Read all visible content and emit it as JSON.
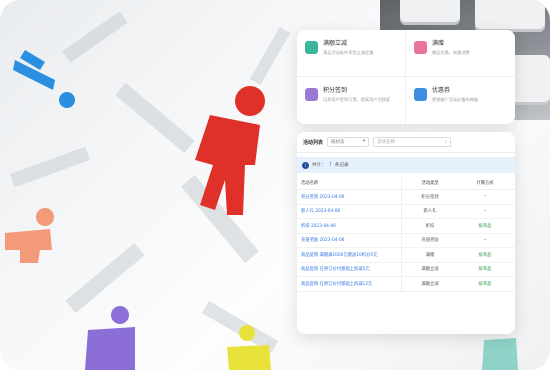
{
  "top_grid": [
    {
      "title": "满额立减",
      "desc": "满足活动条件享受立减优惠",
      "icon": "discount-icon",
      "color": "#3db59b"
    },
    {
      "title": "满赠",
      "desc": "赠品优惠，刺激消费",
      "icon": "gift-icon",
      "color": "#e9739c"
    },
    {
      "title": "积分签到",
      "desc": "培养用户签到习惯，提高用户活跃度",
      "icon": "calendar-icon",
      "color": "#9a7ad6"
    },
    {
      "title": "优惠券",
      "desc": "营销推广活动必备的神器",
      "icon": "coupon-icon",
      "color": "#3d8de0"
    }
  ],
  "list": {
    "tab": "活动列表",
    "status_select": "按状态",
    "search_placeholder": "活动名称",
    "info_prefix": "共计：",
    "info_count": "7",
    "info_suffix": "条记录",
    "columns": [
      "活动名称",
      "活动类型",
      "计算方式",
      ""
    ],
    "rows": [
      {
        "name": "积分签到 2023-04-06",
        "type": "积分签到",
        "calc": "--",
        "extra": "20"
      },
      {
        "name": "新人礼 2023-04-06",
        "type": "新人礼",
        "calc": "--",
        "extra": "20"
      },
      {
        "name": "折扣 2023-04-06",
        "type": "折扣",
        "calc": "按单品",
        "extra": "20"
      },
      {
        "name": "充值奖励 2023-04-06",
        "type": "充值奖励",
        "calc": "--",
        "extra": "20"
      },
      {
        "name": "商品促销 满赠满1000元赠送10积分5元",
        "type": "满赠",
        "calc": "按单品",
        "extra": "20"
      },
      {
        "name": "商品促销 在原订价付基础上再减5元",
        "type": "满额立减",
        "calc": "按单品",
        "extra": "20"
      },
      {
        "name": "商品促销 在原订价付基础上再减12元",
        "type": "满额立减",
        "calc": "按单品",
        "extra": "20"
      }
    ]
  }
}
